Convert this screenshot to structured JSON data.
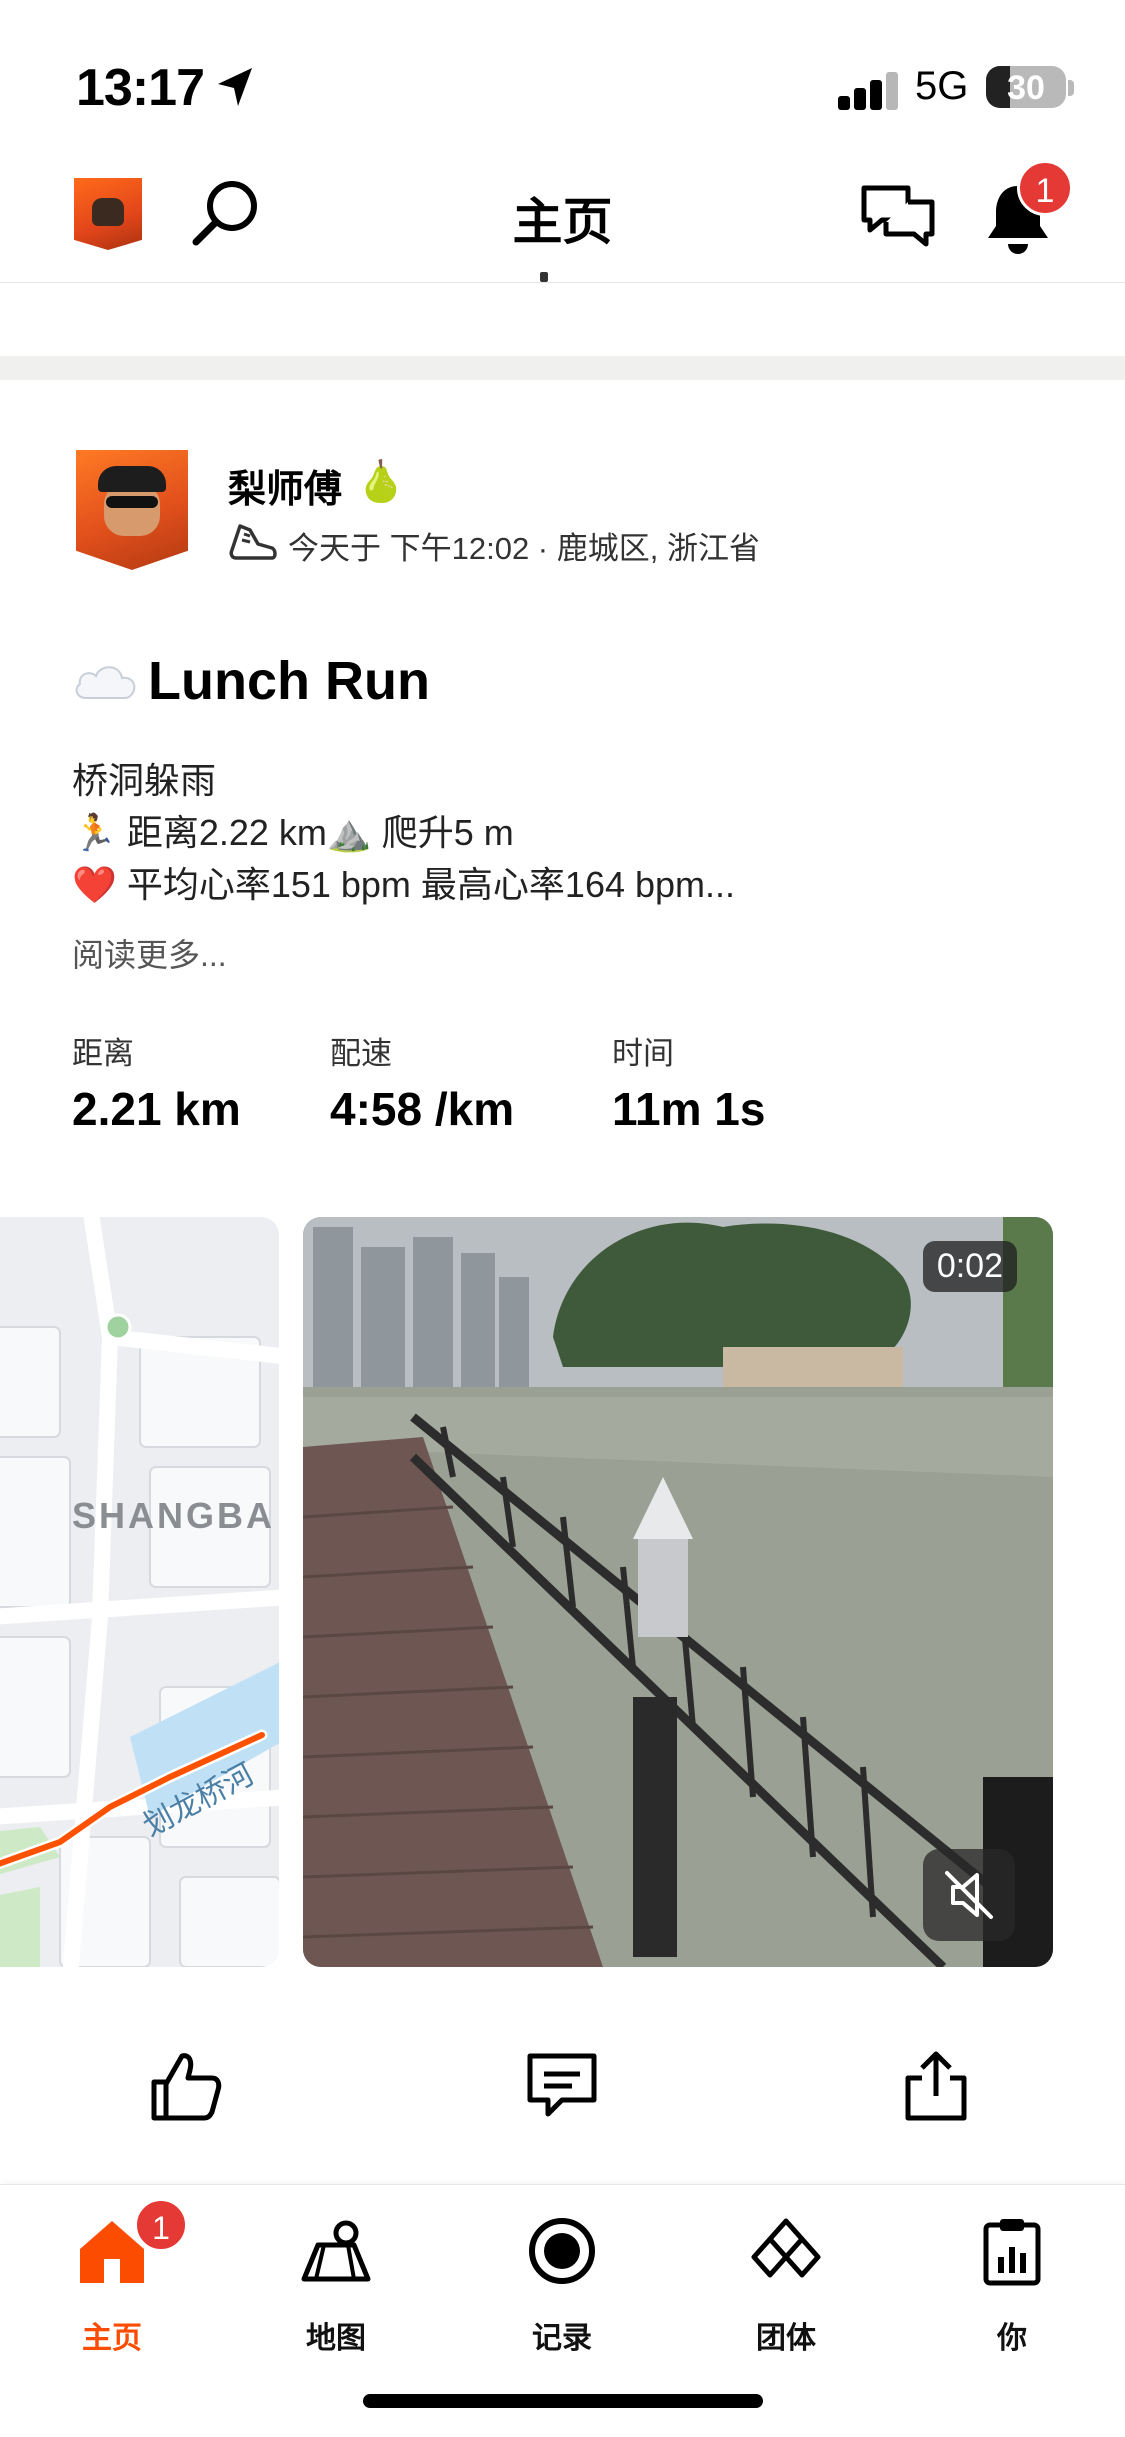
{
  "status_bar": {
    "time": "13:17",
    "network": "5G",
    "battery": "30",
    "battery_level": 0.3
  },
  "header": {
    "title": "主页",
    "notification_count": "1"
  },
  "post": {
    "author": "梨师傅",
    "author_emoji": "🍐",
    "meta": "今天于 下午12:02 · 鹿城区, 浙江省",
    "title": "Lunch Run",
    "description": [
      "桥洞躲雨",
      "🏃 距离2.22 km⛰️ 爬升5 m",
      "❤️ 平均心率151 bpm 最高心率164 bpm..."
    ],
    "read_more": "阅读更多...",
    "stats": [
      {
        "label": "距离",
        "value": "2.21 km"
      },
      {
        "label": "配速",
        "value": "4:58 /km"
      },
      {
        "label": "时间",
        "value": "11m 1s"
      }
    ],
    "map": {
      "area_label": "SHANGBA",
      "street_label": "划龙桥河"
    },
    "video": {
      "duration": "0:02"
    }
  },
  "tabbar": {
    "badge": "1",
    "tabs": [
      {
        "label": "主页",
        "active": true
      },
      {
        "label": "地图"
      },
      {
        "label": "记录"
      },
      {
        "label": "团体"
      },
      {
        "label": "你"
      }
    ]
  },
  "colors": {
    "accent": "#fc4c02",
    "badge": "#e53935",
    "route": "#fc5200"
  }
}
